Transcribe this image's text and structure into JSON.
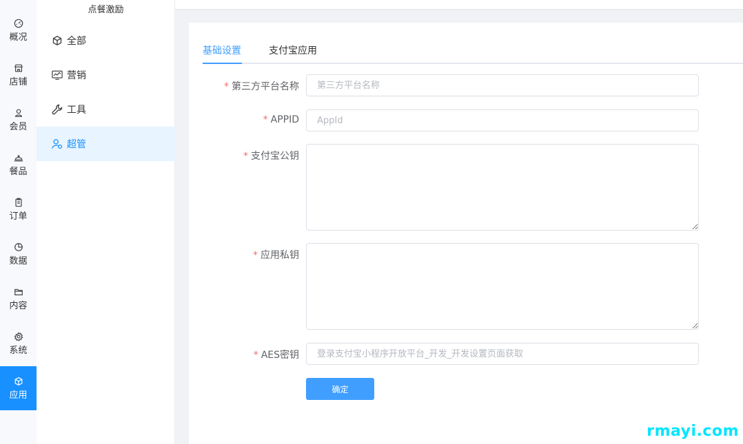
{
  "rail": {
    "items": [
      {
        "label": "概况",
        "icon": "dashboard-icon"
      },
      {
        "label": "店铺",
        "icon": "store-icon"
      },
      {
        "label": "会员",
        "icon": "user-icon"
      },
      {
        "label": "餐品",
        "icon": "dish-cover-icon"
      },
      {
        "label": "订单",
        "icon": "clipboard-icon"
      },
      {
        "label": "数据",
        "icon": "pie-chart-icon"
      },
      {
        "label": "内容",
        "icon": "folder-icon"
      },
      {
        "label": "系统",
        "icon": "gear-icon"
      },
      {
        "label": "应用",
        "icon": "cube-icon"
      }
    ],
    "active_index": 8,
    "active_color": "#1890ff"
  },
  "sub_sidebar": {
    "title": "点餐激励",
    "items": [
      {
        "label": "全部",
        "icon": "cube-icon"
      },
      {
        "label": "营销",
        "icon": "monitor-chart-icon"
      },
      {
        "label": "工具",
        "icon": "wrench-icon"
      },
      {
        "label": "超管",
        "icon": "user-gear-icon"
      }
    ],
    "active_index": 3
  },
  "tabs": {
    "items": [
      {
        "label": "基础设置"
      },
      {
        "label": "支付宝应用"
      }
    ],
    "active_index": 0,
    "active_color": "#409eff"
  },
  "form": {
    "required_mark": "*",
    "platform_name": {
      "label": "第三方平台名称",
      "placeholder": "第三方平台名称",
      "value": ""
    },
    "appid": {
      "label": "APPID",
      "placeholder": "AppId",
      "value": ""
    },
    "alipay_public_key": {
      "label": "支付宝公钥",
      "value": ""
    },
    "app_private_key": {
      "label": "应用私钥",
      "value": ""
    },
    "aes_key": {
      "label": "AES密钥",
      "placeholder": "登录支付宝小程序开放平台_开发_开发设置页面获取",
      "value": ""
    },
    "submit_label": "确定"
  },
  "watermark": "rmayi.com"
}
